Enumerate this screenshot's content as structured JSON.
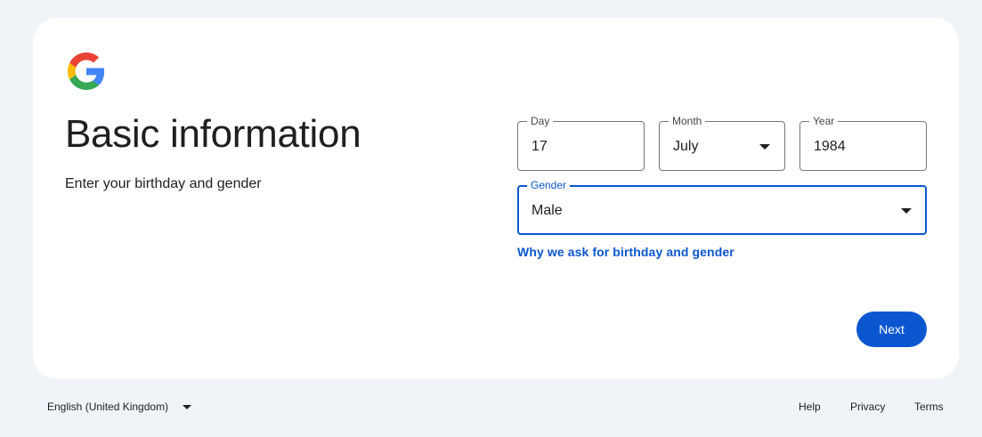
{
  "page": {
    "title": "Basic information",
    "subtitle": "Enter your birthday and gender"
  },
  "form": {
    "day": {
      "label": "Day",
      "value": "17"
    },
    "month": {
      "label": "Month",
      "value": "July"
    },
    "year": {
      "label": "Year",
      "value": "1984"
    },
    "gender": {
      "label": "Gender",
      "value": "Male"
    }
  },
  "links": {
    "why": "Why we ask for birthday and gender"
  },
  "actions": {
    "next_label": "Next"
  },
  "footer": {
    "language": "English (United Kingdom)",
    "help": "Help",
    "privacy": "Privacy",
    "terms": "Terms"
  },
  "icons": {
    "logo": "google-logo-icon",
    "dropdown": "caret-down-icon"
  },
  "colors": {
    "background": "#f0f4f9",
    "card": "#ffffff",
    "accent": "#0b57d0",
    "border": "#747775",
    "text": "#1f1f1f"
  }
}
